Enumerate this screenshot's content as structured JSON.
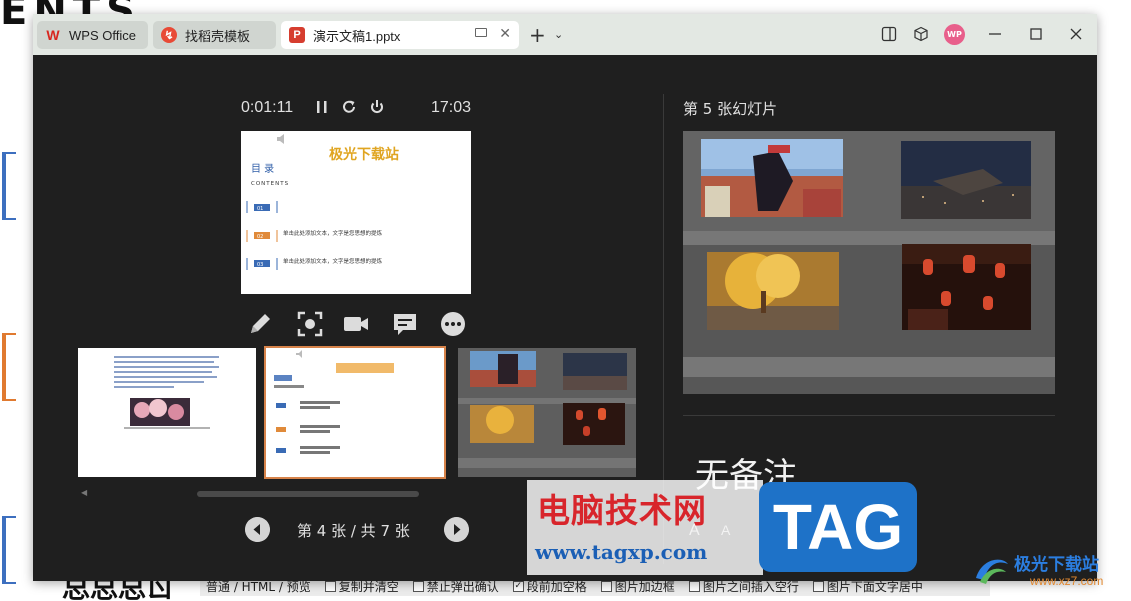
{
  "background_doc": {
    "heading": "ENTS",
    "bottom_text": "总总总ㄖ",
    "options": [
      {
        "label": "复制并清空",
        "checked": false
      },
      {
        "label": "禁止弹出确认",
        "checked": false
      },
      {
        "label": "段前加空格",
        "checked": true
      },
      {
        "label": "图片加边框",
        "checked": false
      },
      {
        "label": "图片之间插入空行",
        "checked": false
      },
      {
        "label": "图片下面文字居中",
        "checked": false
      }
    ],
    "tabs_text": "普通 / HTML / 预览"
  },
  "titlebar": {
    "tabs": [
      {
        "label": "WPS Office",
        "icon": "wps-logo-icon"
      },
      {
        "label": "找稻壳模板",
        "icon": "docer-icon"
      },
      {
        "label": "演示文稿1.pptx",
        "icon": "ppt-file-icon"
      }
    ],
    "avatar_text": "WP",
    "colors": {
      "titlebar": "#e3e8e3",
      "active_tab": "#ffffff"
    }
  },
  "presenter": {
    "elapsed_time": "0:01:11",
    "clock": "17:03",
    "current_slide": {
      "title": "极光下载站",
      "heading": "目 录",
      "subheading": "CONTENTS",
      "items": [
        {
          "num": "01",
          "text": ""
        },
        {
          "num": "02",
          "text": "单击此处添加文本，文字是您思想的提炼"
        },
        {
          "num": "03",
          "text": "单击此处添加文本，文字是您思想的提炼"
        }
      ]
    },
    "page_counter": "第 4 张 / 共 7 张",
    "next_slide_label": "第 5 张幻灯片",
    "notes": "无备注",
    "font_controls": [
      "A",
      "A"
    ]
  },
  "watermark": {
    "title": "电脑技术网",
    "url": "www.tagxp.com",
    "tag": "TAG",
    "corner_name": "极光下载站",
    "corner_url": "www.xz7.com"
  }
}
